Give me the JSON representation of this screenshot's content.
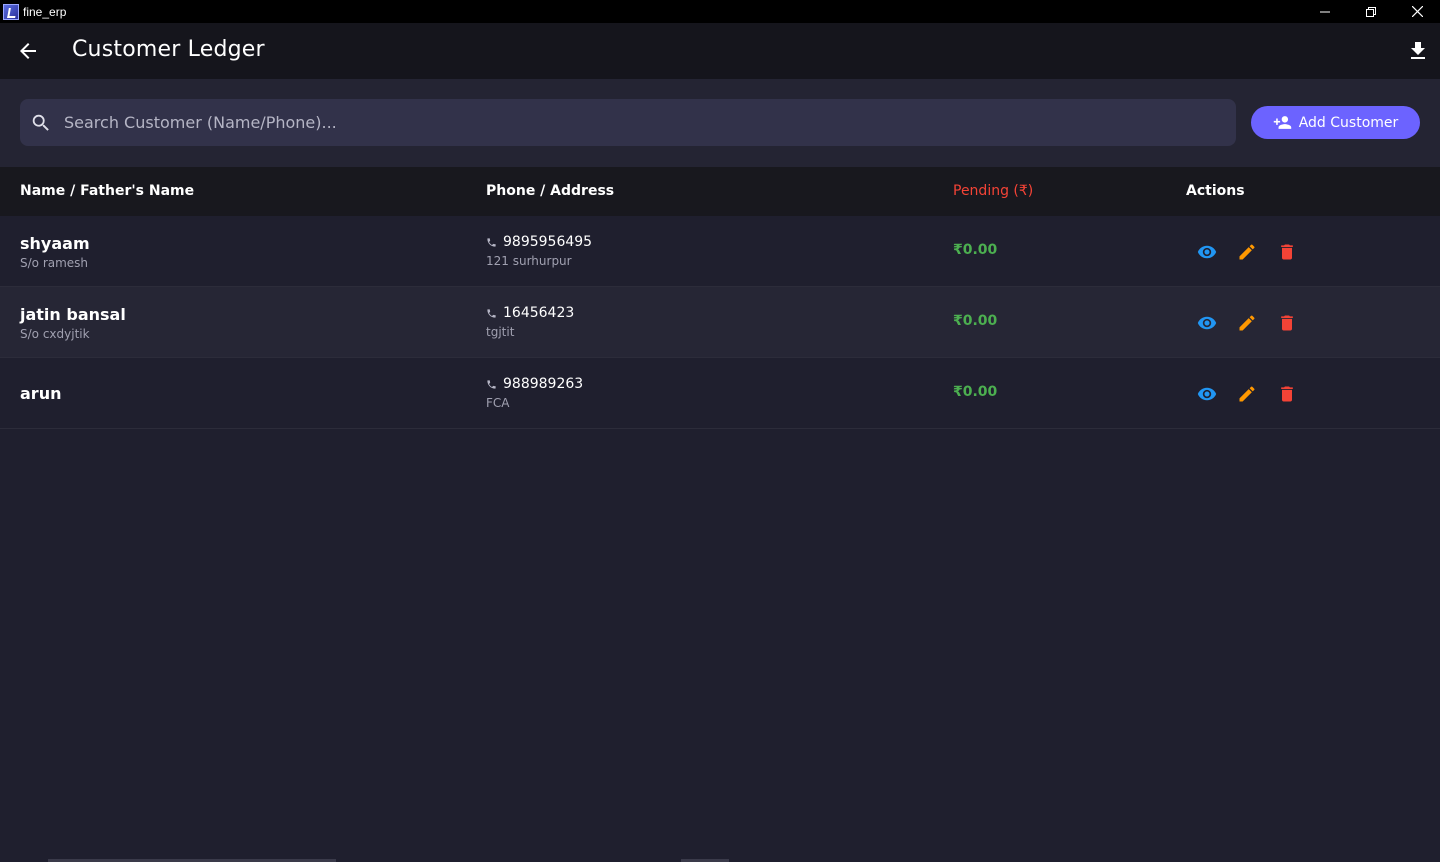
{
  "window": {
    "title": "fine_erp"
  },
  "appbar": {
    "title": "Customer Ledger"
  },
  "search": {
    "placeholder": "Search Customer (Name/Phone)...",
    "value": ""
  },
  "actions": {
    "add_customer_label": "Add Customer"
  },
  "table": {
    "headers": {
      "name": "Name / Father's Name",
      "phone": "Phone / Address",
      "pending": "Pending (₹)",
      "actions": "Actions"
    },
    "rows": [
      {
        "name": "shyaam",
        "father": "S/o ramesh",
        "phone": "9895956495",
        "address": "121 surhurpur",
        "pending": "₹0.00"
      },
      {
        "name": "jatin bansal",
        "father": "S/o cxdyjtik",
        "phone": "16456423",
        "address": "tgjtit",
        "pending": "₹0.00"
      },
      {
        "name": "arun",
        "father": "",
        "phone": "988989263",
        "address": "FCA",
        "pending": "₹0.00"
      }
    ]
  },
  "colors": {
    "accent": "#6c63ff",
    "pending_header": "#f44336",
    "pending_value": "#4caf50",
    "view_icon": "#2196f3",
    "edit_icon": "#ff9800",
    "delete_icon": "#f44336"
  },
  "icons": {
    "back": "arrow-left-icon",
    "download": "download-icon",
    "search": "search-icon",
    "add": "person-add-icon",
    "phone": "phone-icon",
    "view": "eye-icon",
    "edit": "pencil-icon",
    "delete": "trash-icon"
  }
}
